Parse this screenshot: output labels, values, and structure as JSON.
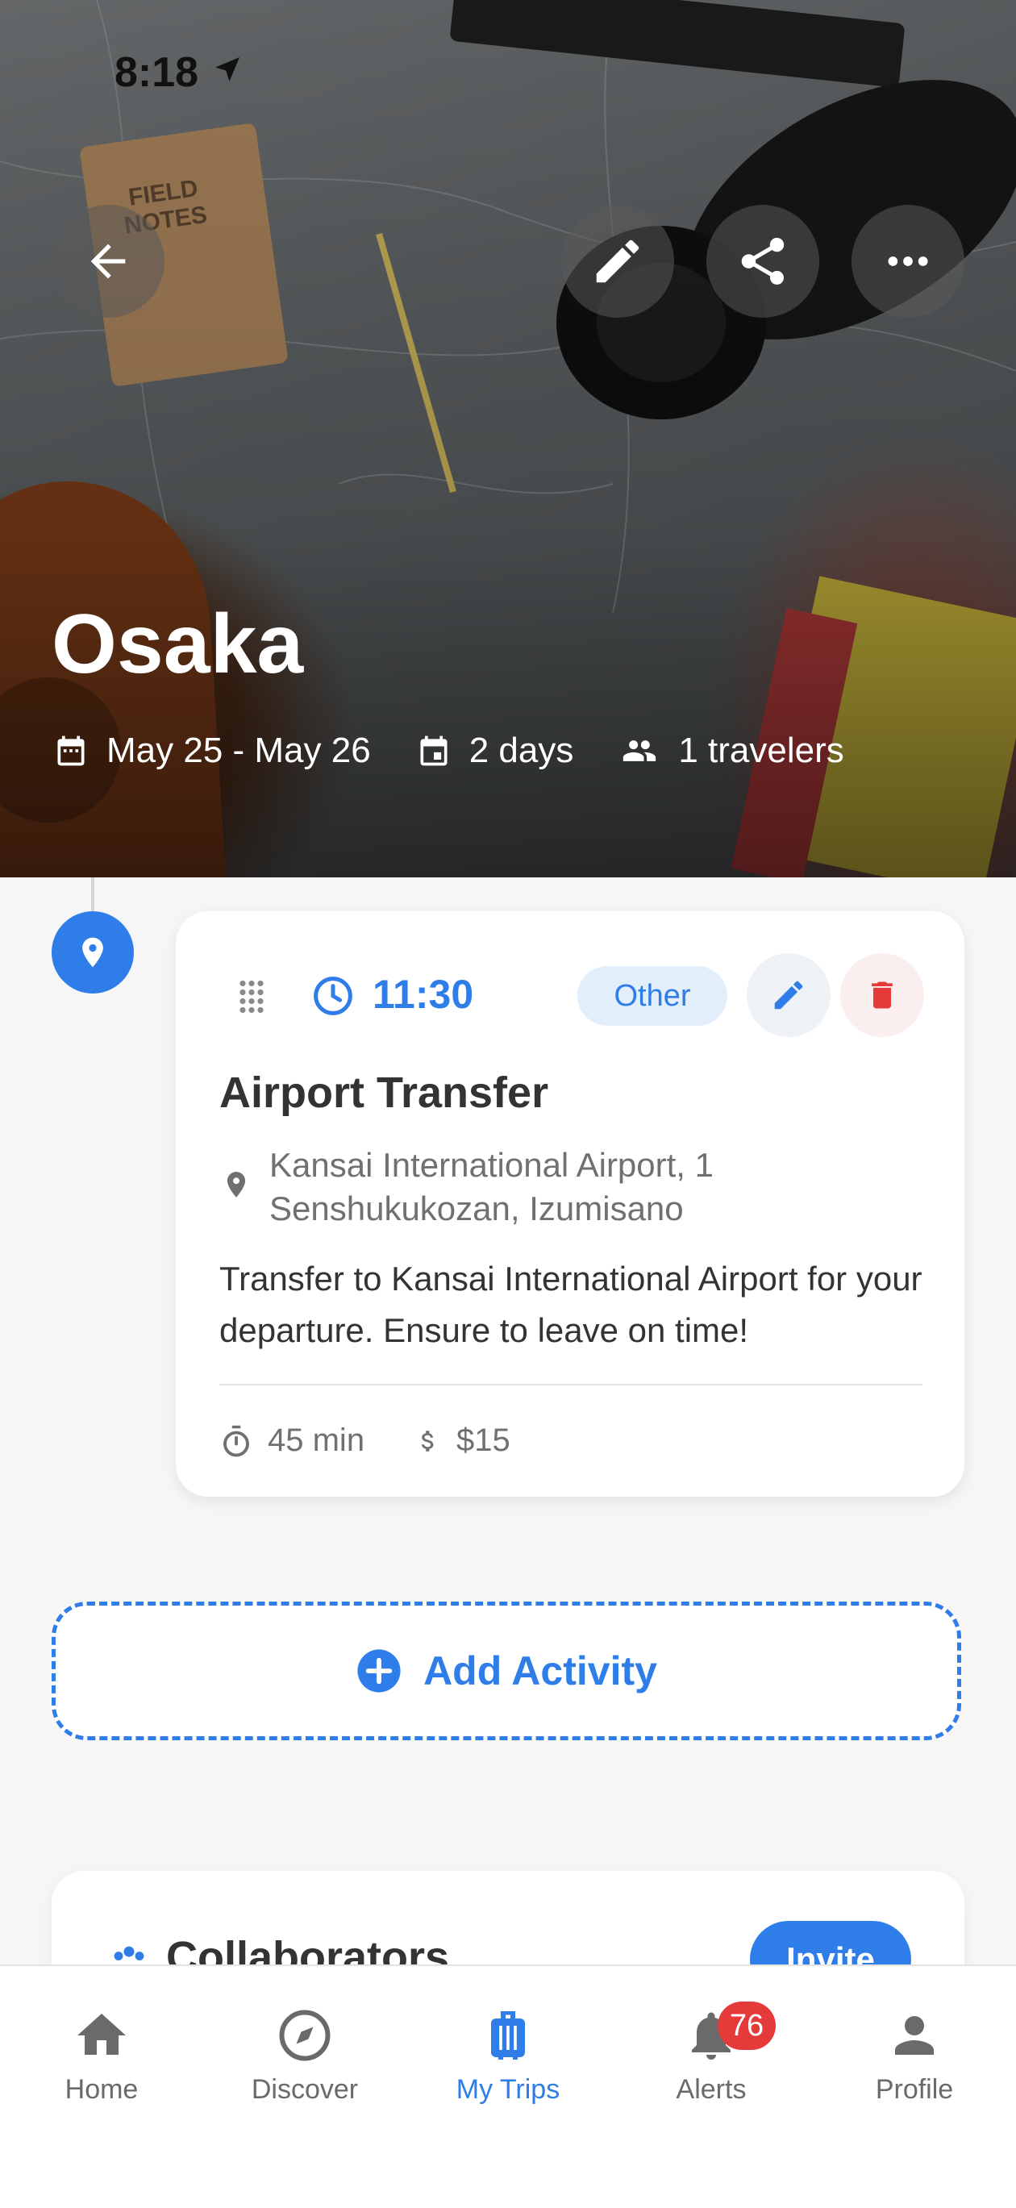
{
  "status_bar": {
    "time": "8:18"
  },
  "trip": {
    "title": "Osaka",
    "dates": "May 25 - May 26",
    "duration": "2 days",
    "travelers": "1 travelers"
  },
  "activity": {
    "time": "11:30",
    "category": "Other",
    "title": "Airport Transfer",
    "address": "Kansai International Airport, 1 Senshukukozan, Izumisano",
    "description": "Transfer to Kansai International Airport for your departure. Ensure to leave on time!",
    "duration": "45 min",
    "cost": "$15"
  },
  "add_activity_label": "Add Activity",
  "collaborators": {
    "title": "Collaborators",
    "invite_label": "Invite"
  },
  "tabs": [
    {
      "label": "Home",
      "icon": "home-icon"
    },
    {
      "label": "Discover",
      "icon": "compass-icon"
    },
    {
      "label": "My Trips",
      "icon": "luggage-icon",
      "active": true
    },
    {
      "label": "Alerts",
      "icon": "bell-icon",
      "badge": "76"
    },
    {
      "label": "Profile",
      "icon": "person-icon"
    }
  ],
  "colors": {
    "accent": "#2f7de8",
    "danger": "#e53a3a",
    "chip_bg": "#e3eefb"
  }
}
